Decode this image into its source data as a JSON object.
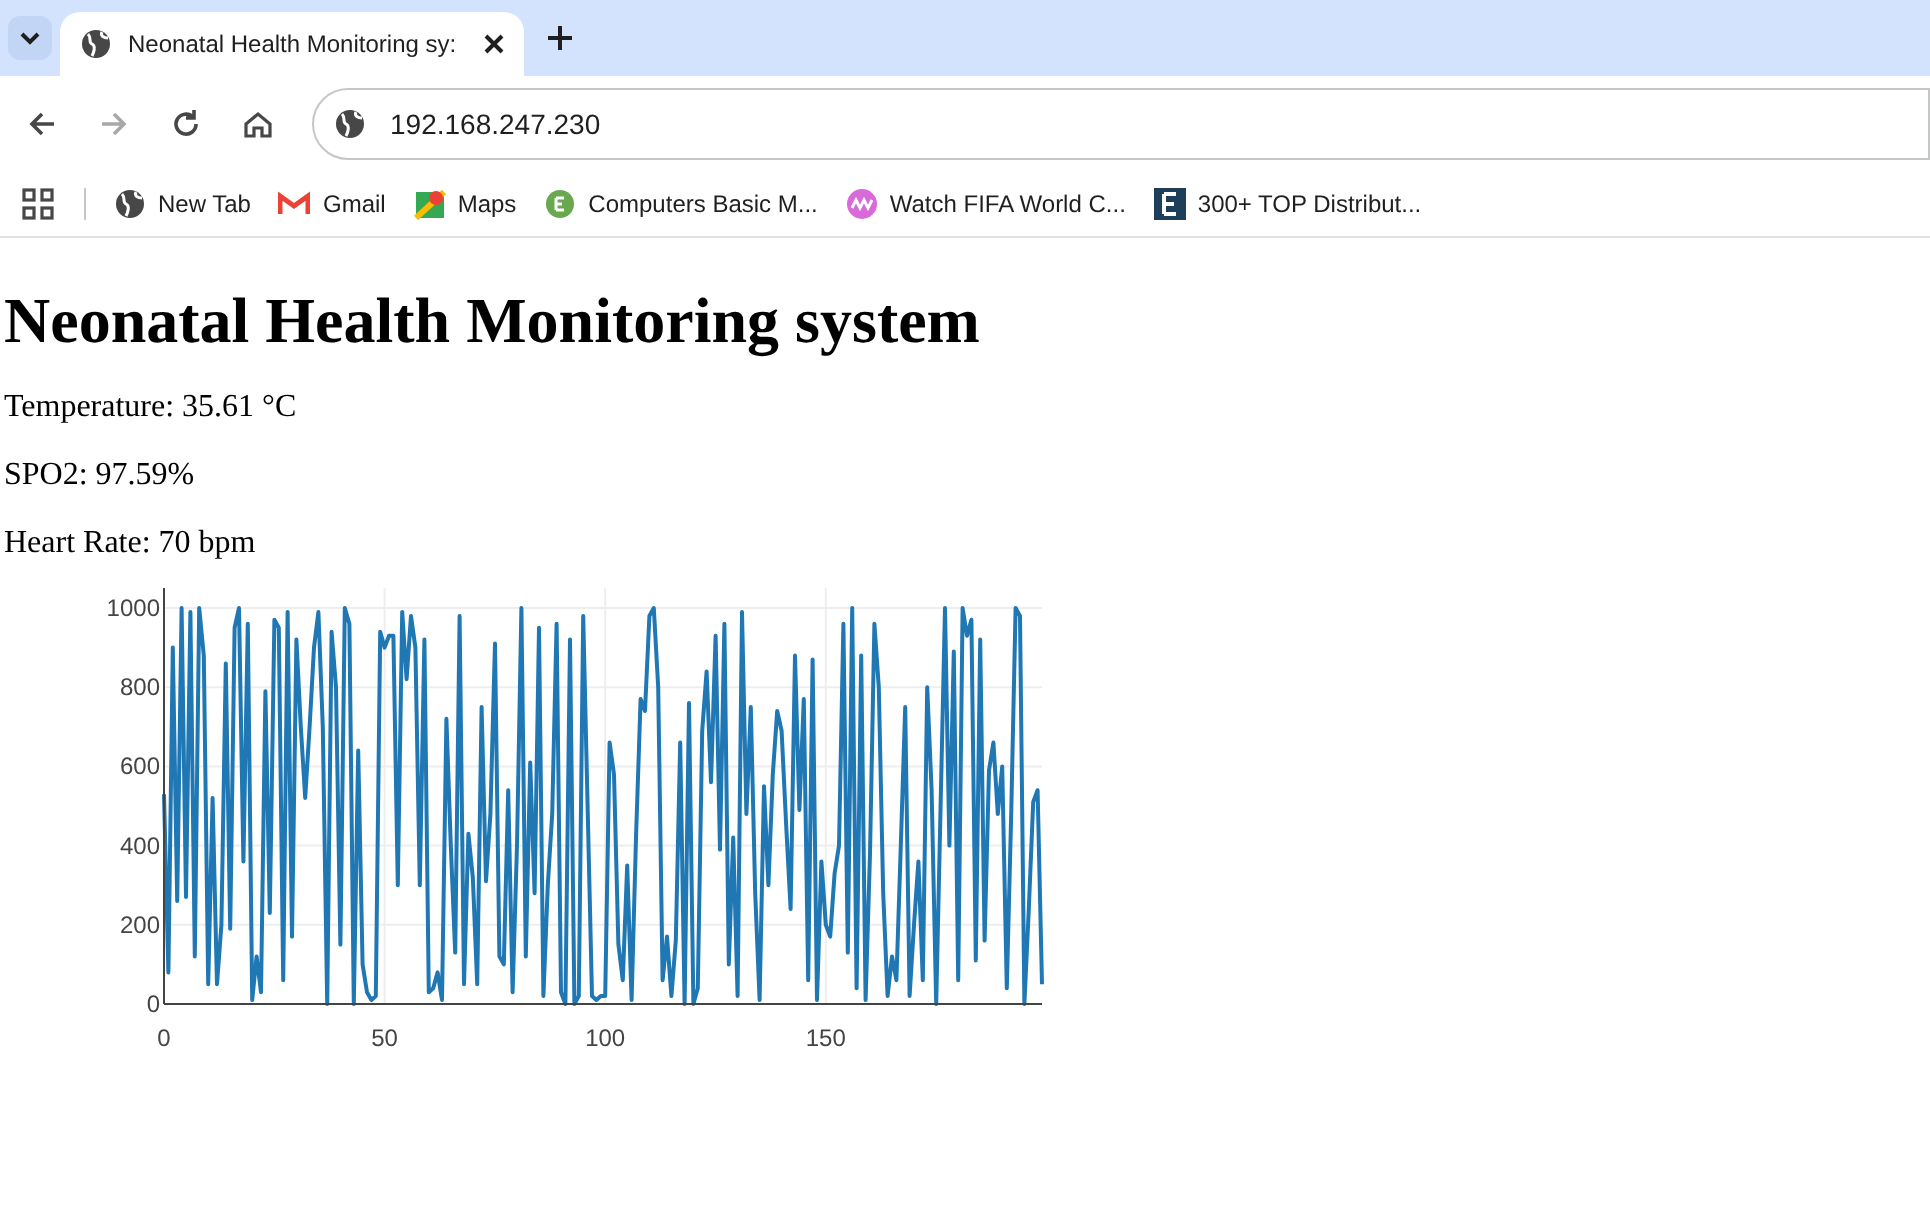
{
  "browser": {
    "tabs": [
      {
        "title": "Neonatal Health Monitoring sy:",
        "selected": true
      }
    ],
    "nav_buttons": [
      {
        "kind": "back",
        "disabled": false
      },
      {
        "kind": "forward",
        "disabled": true
      },
      {
        "kind": "reload",
        "disabled": false
      },
      {
        "kind": "home",
        "disabled": false
      }
    ],
    "address": "192.168.247.230",
    "bookmarks": [
      {
        "kind": "globe",
        "label": "New Tab"
      },
      {
        "kind": "mail",
        "label": "Gmail"
      },
      {
        "kind": "map",
        "label": "Maps"
      },
      {
        "kind": "badge",
        "label": "Computers Basic M..."
      },
      {
        "kind": "wave",
        "label": "Watch FIFA World C..."
      },
      {
        "kind": "letter",
        "label": "300+ TOP Distribut..."
      }
    ]
  },
  "page": {
    "heading": "Neonatal Health Monitoring system",
    "readings": [
      "Temperature: 35.61 °C",
      "SPO2: 97.59%",
      "Heart Rate: 70 bpm"
    ],
    "chart_data": {
      "type": "line",
      "grid": true,
      "x": [
        0,
        1,
        2,
        3,
        4,
        5,
        6,
        7,
        8,
        9,
        10,
        11,
        12,
        13,
        14,
        15,
        16,
        17,
        18,
        19,
        20,
        21,
        22,
        23,
        24,
        25,
        26,
        27,
        28,
        29,
        30,
        31,
        32,
        33,
        34,
        35,
        36,
        37,
        38,
        39,
        40,
        41,
        42,
        43,
        44,
        45,
        46,
        47,
        48,
        49,
        50,
        51,
        52,
        53,
        54,
        55,
        56,
        57,
        58,
        59,
        60,
        61,
        62,
        63,
        64,
        65,
        66,
        67,
        68,
        69,
        70,
        71,
        72,
        73,
        74,
        75,
        76,
        77,
        78,
        79,
        80,
        81,
        82,
        83,
        84,
        85,
        86,
        87,
        88,
        89,
        90,
        91,
        92,
        93,
        94,
        95,
        96,
        97,
        98,
        99,
        100,
        101,
        102,
        103,
        104,
        105,
        106,
        107,
        108,
        109,
        110,
        111,
        112,
        113,
        114,
        115,
        116,
        117,
        118,
        119,
        120,
        121,
        122,
        123,
        124,
        125,
        126,
        127,
        128,
        129,
        130,
        131,
        132,
        133,
        134,
        135,
        136,
        137,
        138,
        139,
        140,
        141,
        142,
        143,
        144,
        145,
        146,
        147,
        148,
        149,
        150,
        151,
        152,
        153,
        154,
        155,
        156,
        157,
        158,
        159,
        160,
        161,
        162,
        163,
        164,
        165,
        166,
        167,
        168,
        169,
        170,
        171,
        172,
        173,
        174,
        175,
        176,
        177,
        178,
        179,
        180,
        181,
        182,
        183,
        184,
        185,
        186,
        187,
        188,
        189,
        190,
        191,
        192,
        193,
        194,
        195,
        196,
        197,
        198,
        199
      ],
      "xlim": [
        0,
        199
      ],
      "ylim": [
        0,
        1000
      ],
      "xticks": [
        0,
        50,
        100,
        150
      ],
      "yticks": [
        0,
        200,
        400,
        600,
        800,
        1000
      ],
      "series": [
        {
          "color": "#1f77b4",
          "values": [
            530,
            80,
            900,
            260,
            1000,
            270,
            990,
            120,
            1000,
            880,
            50,
            520,
            50,
            200,
            860,
            190,
            950,
            1000,
            360,
            960,
            10,
            120,
            30,
            790,
            230,
            970,
            950,
            60,
            990,
            170,
            920,
            700,
            520,
            700,
            900,
            990,
            700,
            0,
            940,
            800,
            150,
            1000,
            960,
            0,
            640,
            100,
            30,
            10,
            20,
            940,
            900,
            930,
            930,
            300,
            990,
            820,
            980,
            900,
            300,
            920,
            30,
            40,
            80,
            10,
            720,
            400,
            130,
            980,
            50,
            430,
            320,
            50,
            750,
            310,
            480,
            910,
            120,
            100,
            540,
            30,
            400,
            1000,
            120,
            610,
            280,
            950,
            20,
            300,
            480,
            960,
            30,
            0,
            920,
            0,
            20,
            980,
            500,
            20,
            10,
            20,
            20,
            660,
            580,
            150,
            60,
            350,
            10,
            420,
            770,
            740,
            980,
            1000,
            800,
            60,
            170,
            20,
            160,
            660,
            0,
            760,
            0,
            40,
            690,
            840,
            560,
            930,
            390,
            960,
            100,
            420,
            20,
            990,
            480,
            750,
            280,
            10,
            550,
            300,
            580,
            740,
            690,
            450,
            240,
            880,
            490,
            770,
            60,
            870,
            10,
            360,
            200,
            170,
            330,
            400,
            960,
            130,
            1000,
            40,
            880,
            10,
            380,
            960,
            800,
            280,
            20,
            120,
            60,
            400,
            750,
            20,
            200,
            360,
            60,
            800,
            540,
            0,
            500,
            1000,
            400,
            890,
            60,
            1000,
            930,
            970,
            110,
            920,
            160,
            590,
            660,
            480,
            600,
            40,
            480,
            1000,
            980,
            0,
            240,
            510,
            540,
            50
          ]
        }
      ]
    }
  }
}
